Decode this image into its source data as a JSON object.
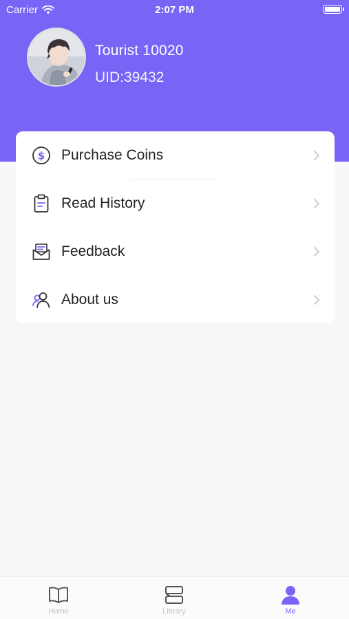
{
  "status_bar": {
    "carrier": "Carrier",
    "time": "2:07 PM"
  },
  "profile": {
    "name": "Tourist 10020",
    "uid": "UID:39432"
  },
  "menu": {
    "items": [
      {
        "label": "Purchase Coins",
        "icon": "dollar-coin-icon"
      },
      {
        "label": "Read History",
        "icon": "clipboard-icon"
      },
      {
        "label": "Feedback",
        "icon": "envelope-icon"
      },
      {
        "label": "About us",
        "icon": "users-icon"
      }
    ]
  },
  "tab_bar": {
    "tabs": [
      {
        "label": "Home",
        "icon": "book-icon",
        "active": false
      },
      {
        "label": "Library",
        "icon": "library-icon",
        "active": false
      },
      {
        "label": "Me",
        "icon": "person-icon",
        "active": true
      }
    ]
  },
  "colors": {
    "accent": "#7864f5",
    "background": "#f7f6f8",
    "card": "#ffffff",
    "text": "#222222",
    "inactive_tab": "#c3c3c8"
  }
}
